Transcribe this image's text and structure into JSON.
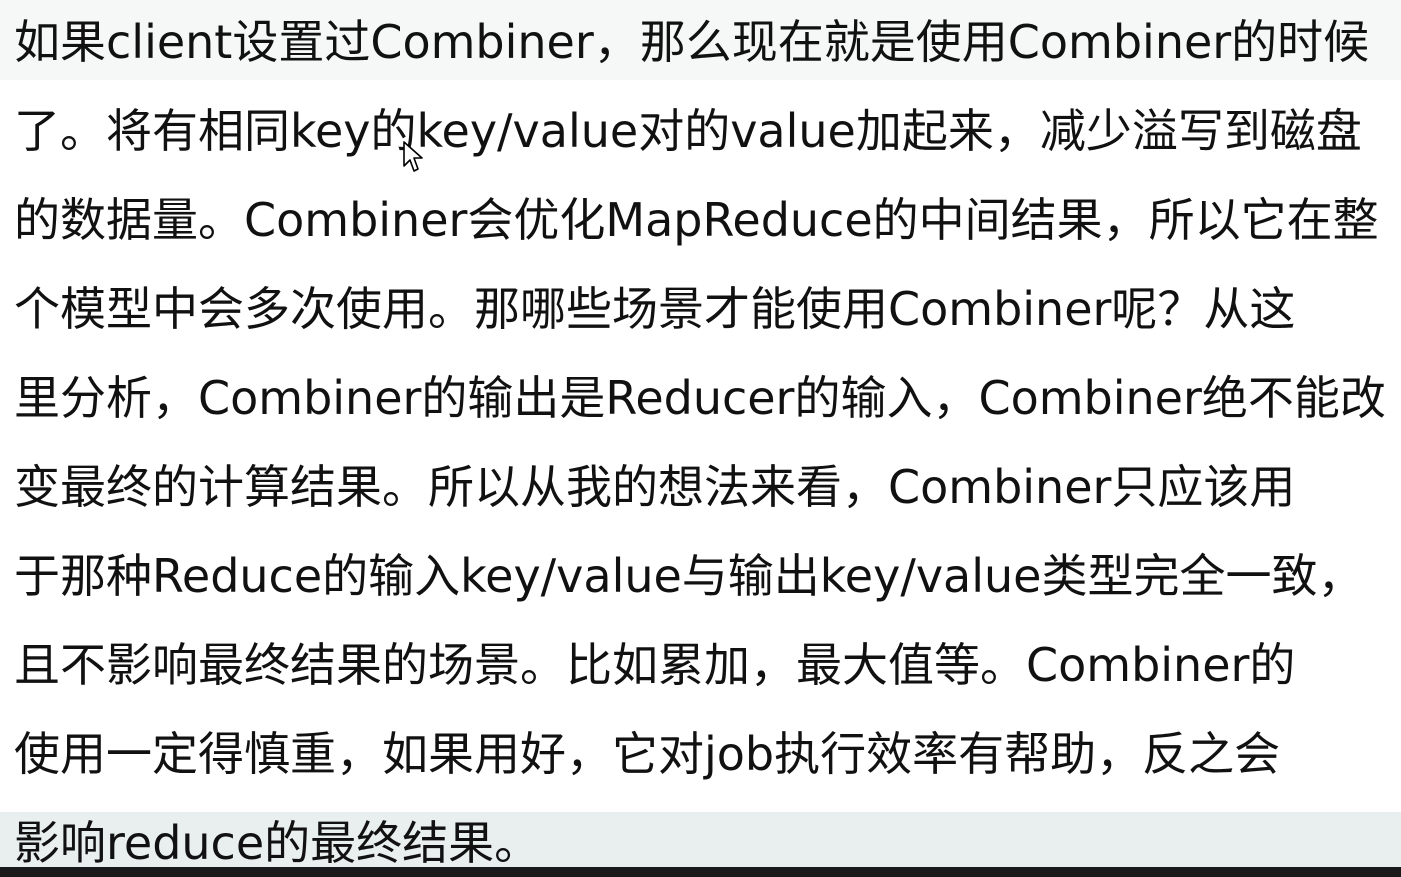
{
  "paragraph": {
    "lines": [
      "如果client设置过Combiner，那么现在就是使用Combiner的时候",
      "了。将有相同key的key/value对的value加起来，减少溢写到磁盘",
      "的数据量。Combiner会优化MapReduce的中间结果，所以它在整",
      "个模型中会多次使用。那哪些场景才能使用Combiner呢？从这",
      "里分析，Combiner的输出是Reducer的输入，Combiner绝不能改",
      "变最终的计算结果。所以从我的想法来看，Combiner只应该用",
      "于那种Reduce的输入key/value与输出key/value类型完全一致，",
      "且不影响最终结果的场景。比如累加，最大值等。Combiner的",
      "使用一定得慎重，如果用好，它对job执行效率有帮助，反之会",
      "影响reduce的最终结果。"
    ]
  },
  "colors": {
    "text": "#111111",
    "band_top": "#f5f8f6",
    "band_bottom": "#e9efee"
  },
  "icons": {
    "pointer": "mouse-pointer-icon"
  }
}
